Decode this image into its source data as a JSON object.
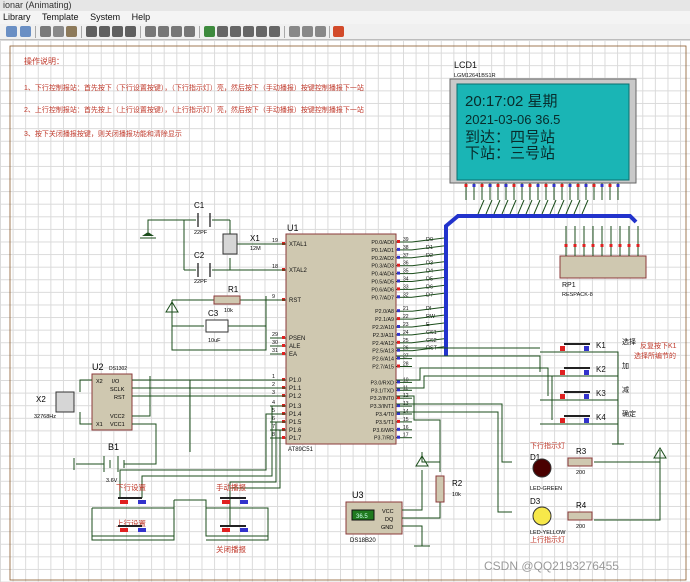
{
  "window": {
    "title": "ionar (Animating)"
  },
  "menu": [
    "Library",
    "Template",
    "System",
    "Help"
  ],
  "instructions": {
    "heading": "操作说明：",
    "lines": [
      "1、下行控制报站：首先按下（下行设置按键），（下行指示灯）亮，然后按下（手动播报）按键控制播报下一站",
      "2、上行控制报站：首先按上（上行设置按键），（上行指示灯）亮，然后按下（手动播报）按键控制播报下一站",
      "3、按下关闭播报按键，则关闭播报功能和清除显示"
    ]
  },
  "lcd": {
    "ref": "LCD1",
    "part": "LGM12641BS1R",
    "row1": "20:17:02  星期",
    "row2": "2021-03-06   36.5",
    "row3": "到达：四号站",
    "row4": "下站：三号站"
  },
  "mcu": {
    "ref": "U1",
    "part": "AT89C51",
    "left_pins": [
      {
        "num": "19",
        "name": "XTAL1"
      },
      {
        "num": "18",
        "name": "XTAL2"
      },
      {
        "num": "9",
        "name": "RST"
      },
      {
        "num": "29",
        "name": "PSEN"
      },
      {
        "num": "30",
        "name": "ALE"
      },
      {
        "num": "31",
        "name": "EA"
      },
      {
        "num": "1",
        "name": "P1.0"
      },
      {
        "num": "2",
        "name": "P1.1"
      },
      {
        "num": "3",
        "name": "P1.2"
      },
      {
        "num": "4",
        "name": "P1.3"
      },
      {
        "num": "5",
        "name": "P1.4"
      },
      {
        "num": "6",
        "name": "P1.5"
      },
      {
        "num": "7",
        "name": "P1.6"
      },
      {
        "num": "8",
        "name": "P1.7"
      }
    ],
    "right_pins": [
      {
        "num": "39",
        "name": "P0.0/AD0",
        "net": "D0"
      },
      {
        "num": "38",
        "name": "P0.1/AD1",
        "net": "D1"
      },
      {
        "num": "37",
        "name": "P0.2/AD2",
        "net": "D2"
      },
      {
        "num": "36",
        "name": "P0.3/AD3",
        "net": "D3"
      },
      {
        "num": "35",
        "name": "P0.4/AD4",
        "net": "D4"
      },
      {
        "num": "34",
        "name": "P0.5/AD5",
        "net": "D5"
      },
      {
        "num": "33",
        "name": "P0.6/AD6",
        "net": "D6"
      },
      {
        "num": "32",
        "name": "P0.7/AD7",
        "net": "D7"
      },
      {
        "num": "21",
        "name": "P2.0/A8",
        "net": "DI"
      },
      {
        "num": "22",
        "name": "P2.1/A9",
        "net": "RW"
      },
      {
        "num": "23",
        "name": "P2.2/A10",
        "net": "E"
      },
      {
        "num": "24",
        "name": "P2.3/A11",
        "net": "CS1"
      },
      {
        "num": "25",
        "name": "P2.4/A12",
        "net": "CS2"
      },
      {
        "num": "26",
        "name": "P2.5/A13",
        "net": "RST"
      },
      {
        "num": "27",
        "name": "P2.6/A14",
        "net": ""
      },
      {
        "num": "28",
        "name": "P2.7/A15",
        "net": ""
      },
      {
        "num": "10",
        "name": "P3.0/RXD",
        "net": ""
      },
      {
        "num": "11",
        "name": "P3.1/TXD",
        "net": ""
      },
      {
        "num": "12",
        "name": "P3.2/INT0",
        "net": ""
      },
      {
        "num": "13",
        "name": "P3.3/INT1",
        "net": ""
      },
      {
        "num": "14",
        "name": "P3.4/T0",
        "net": ""
      },
      {
        "num": "15",
        "name": "P3.5/T1",
        "net": ""
      },
      {
        "num": "16",
        "name": "P3.6/WR",
        "net": ""
      },
      {
        "num": "17",
        "name": "P3.7/RD",
        "net": ""
      }
    ]
  },
  "components": {
    "c1": {
      "ref": "C1",
      "value": "22PF"
    },
    "c2": {
      "ref": "C2",
      "value": "22PF"
    },
    "c3": {
      "ref": "C3",
      "value": "10uF"
    },
    "x1": {
      "ref": "X1",
      "value": "12M"
    },
    "r1": {
      "ref": "R1",
      "value": "10k"
    },
    "rp1": {
      "ref": "RP1",
      "value": "RESPACK-8"
    },
    "u2": {
      "ref": "U2",
      "part": "DS1302",
      "pins_left": [
        "X2",
        "X1"
      ],
      "pins_right": [
        "I/O",
        "SCLK",
        "RST",
        "VCC2",
        "VCC1"
      ]
    },
    "x2": {
      "ref": "X2",
      "value": "32768Hz"
    },
    "b1": {
      "ref": "B1",
      "value": "3.6V"
    },
    "u3": {
      "ref": "U3",
      "part": "DS18B20",
      "display": "36.5",
      "pins": [
        "VCC",
        "DQ",
        "GND"
      ]
    },
    "r2": {
      "ref": "R2",
      "value": "10k"
    },
    "r3": {
      "ref": "R3",
      "value": "200"
    },
    "r4": {
      "ref": "R4",
      "value": "200"
    },
    "d1": {
      "ref": "D1",
      "part": "LED-GREEN",
      "label": "下行指示灯"
    },
    "d3": {
      "ref": "D3",
      "part": "LED-YELLOW",
      "label": "上行指示灯"
    }
  },
  "keys": [
    {
      "ref": "K1",
      "label": "选择"
    },
    {
      "ref": "K2",
      "label": "加"
    },
    {
      "ref": "K3",
      "label": "减"
    },
    {
      "ref": "K4",
      "label": "确定"
    }
  ],
  "key_note": [
    "反复按下K1",
    "选择所编节的"
  ],
  "buttons": [
    "下行设置",
    "手动播报",
    "上行设置",
    "关闭播报"
  ],
  "watermark": "CSDN @QQ2193276455",
  "colors": {
    "wire": "#1b4d1b",
    "bus": "#2233cc",
    "chip": "#cfc8b0",
    "lcd": "#1ab5b5",
    "instructions": "#c0392b"
  }
}
